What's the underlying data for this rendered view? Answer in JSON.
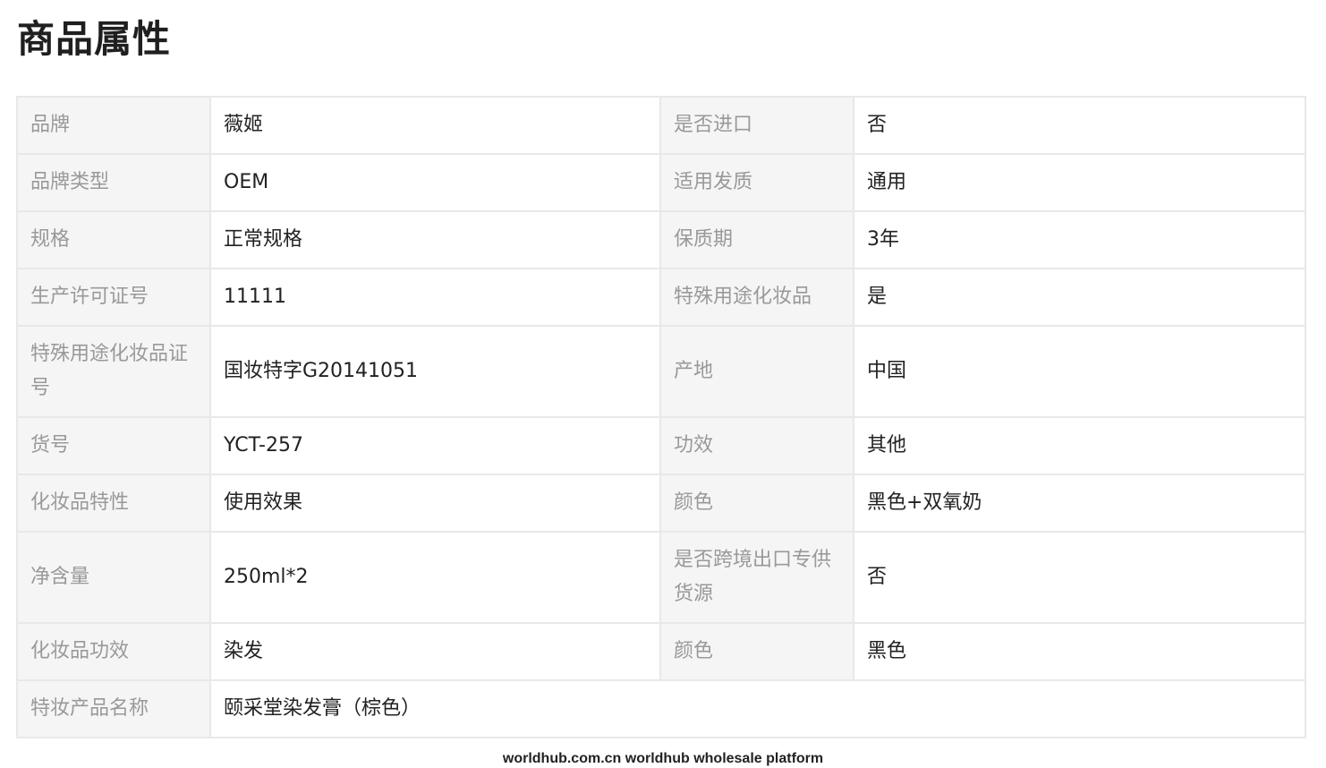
{
  "title": "商品属性",
  "rows": [
    {
      "l1": "品牌",
      "v1": "薇姬",
      "l2": "是否进口",
      "v2": "否"
    },
    {
      "l1": "品牌类型",
      "v1": "OEM",
      "l2": "适用发质",
      "v2": "通用"
    },
    {
      "l1": "规格",
      "v1": "正常规格",
      "l2": "保质期",
      "v2": "3年"
    },
    {
      "l1": "生产许可证号",
      "v1": "11111",
      "l2": "特殊用途化妆品",
      "v2": "是"
    },
    {
      "l1": "特殊用途化妆品证号",
      "v1": "国妆特字G20141051",
      "l2": "产地",
      "v2": "中国"
    },
    {
      "l1": "货号",
      "v1": "YCT-257",
      "l2": "功效",
      "v2": "其他"
    },
    {
      "l1": "化妆品特性",
      "v1": "使用效果",
      "l2": "颜色",
      "v2": "黑色+双氧奶"
    },
    {
      "l1": "净含量",
      "v1": "250ml*2",
      "l2": "是否跨境出口专供货源",
      "v2": "否"
    },
    {
      "l1": "化妆品功效",
      "v1": "染发",
      "l2": "颜色",
      "v2": "黑色"
    },
    {
      "l1": "特妆产品名称",
      "v1": "颐采堂染发膏（棕色）"
    }
  ],
  "footer": "worldhub.com.cn worldhub wholesale platform"
}
